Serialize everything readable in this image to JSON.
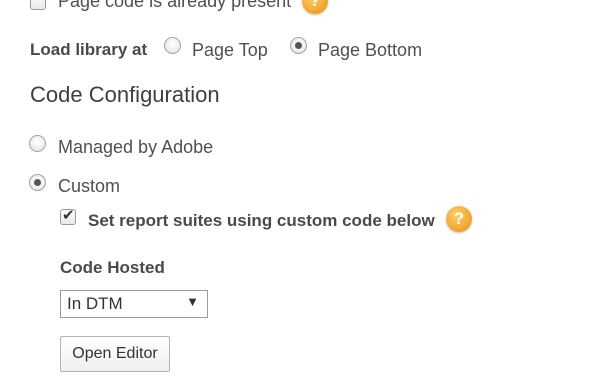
{
  "top": {
    "page_code_label": "Page code is already present",
    "page_code_checked": false,
    "help_glyph": "?"
  },
  "load_library": {
    "label": "Load library at",
    "options": [
      "Page Top",
      "Page Bottom"
    ],
    "selected": "Page Bottom"
  },
  "code_configuration": {
    "title": "Code Configuration",
    "options": [
      "Managed by Adobe",
      "Custom"
    ],
    "selected": "Custom",
    "custom": {
      "set_report_suites_label": "Set report suites using custom code below",
      "set_report_suites_checked": true,
      "checkmark_glyph": "✔",
      "help_glyph": "?",
      "code_hosted_label": "Code Hosted",
      "code_hosted_value": "In DTM",
      "dropdown_arrow": "▼",
      "open_editor_label": "Open Editor"
    }
  },
  "colors": {
    "help_icon": "#f0a229",
    "text": "#505050"
  }
}
